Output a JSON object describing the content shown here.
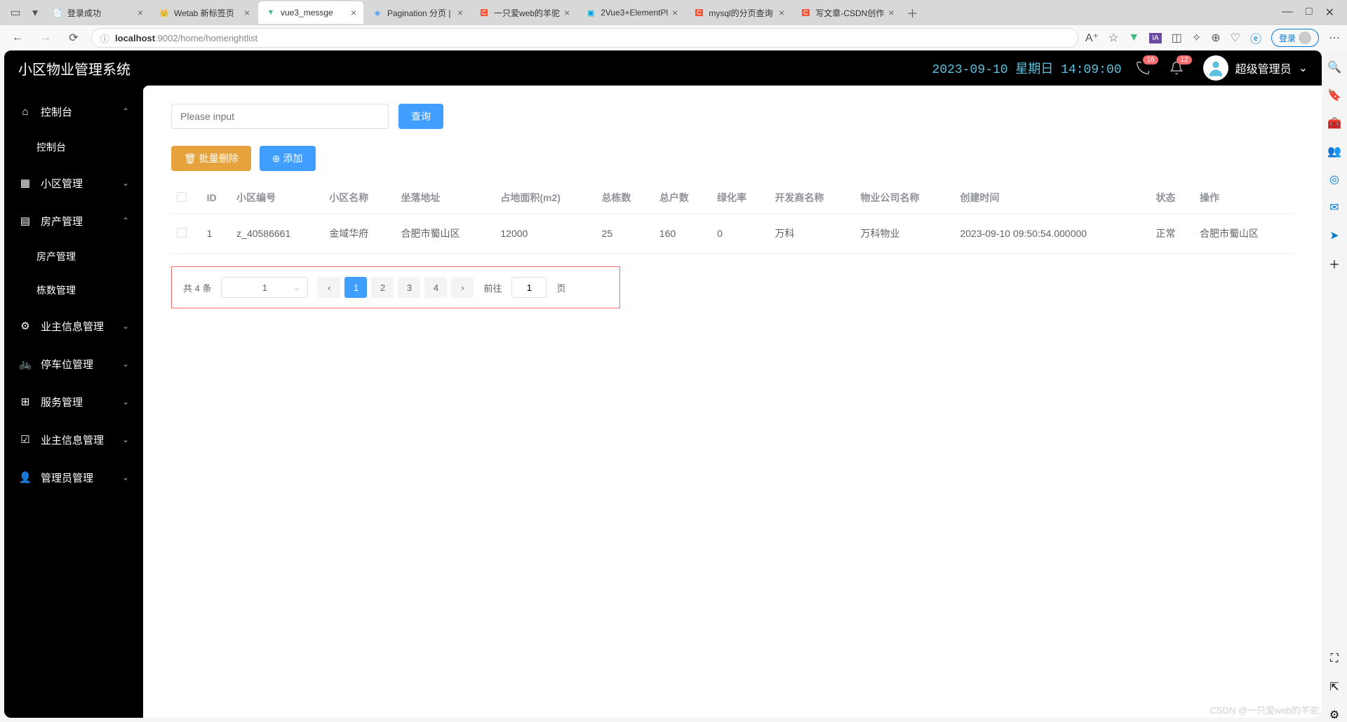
{
  "browser": {
    "tabs": [
      {
        "title": "登录成功",
        "active": false,
        "icon": "page"
      },
      {
        "title": "Wetab 新标签页",
        "active": false,
        "icon": "wetab"
      },
      {
        "title": "vue3_messge",
        "active": true,
        "icon": "vue"
      },
      {
        "title": "Pagination 分页 |",
        "active": false,
        "icon": "element"
      },
      {
        "title": "一只爱web的羊驼",
        "active": false,
        "icon": "csdn"
      },
      {
        "title": "2Vue3+ElementPl",
        "active": false,
        "icon": "bili"
      },
      {
        "title": "mysql的分页查询",
        "active": false,
        "icon": "csdn"
      },
      {
        "title": "写文章-CSDN创作",
        "active": false,
        "icon": "csdn"
      }
    ],
    "url_host": "localhost",
    "url_port": ":9002",
    "url_path": "/home/homerightlist",
    "login_label": "登录"
  },
  "header": {
    "app_title": "小区物业管理系统",
    "datetime": "2023-09-10 星期日 14:09:00",
    "badge1": "16",
    "badge2": "12",
    "user_role": "超级管理员"
  },
  "sidebar": {
    "items": [
      {
        "label": "控制台",
        "icon": "⌂",
        "expanded": true,
        "children": [
          {
            "label": "控制台"
          }
        ]
      },
      {
        "label": "小区管理",
        "icon": "▦",
        "expanded": false
      },
      {
        "label": "房产管理",
        "icon": "▤",
        "expanded": true,
        "children": [
          {
            "label": "房产管理"
          },
          {
            "label": "栋数管理"
          }
        ]
      },
      {
        "label": "业主信息管理",
        "icon": "⚙",
        "expanded": false
      },
      {
        "label": "停车位管理",
        "icon": "🚲",
        "expanded": false
      },
      {
        "label": "服务管理",
        "icon": "⊞",
        "expanded": false
      },
      {
        "label": "业主信息管理",
        "icon": "☑",
        "expanded": false
      },
      {
        "label": "管理员管理",
        "icon": "👤",
        "expanded": false
      }
    ]
  },
  "content": {
    "search_placeholder": "Please input",
    "query_btn": "查询",
    "batch_delete_btn": "批量删除",
    "add_btn": "添加",
    "columns": [
      "",
      "ID",
      "小区编号",
      "小区名称",
      "坐落地址",
      "占地面积(m2)",
      "总栋数",
      "总户数",
      "绿化率",
      "开发商名称",
      "物业公司名称",
      "创建时间",
      "状态",
      "操作"
    ],
    "rows": [
      {
        "id": "1",
        "code": "z_40586661",
        "name": "金域华府",
        "addr": "合肥市蜀山区",
        "area": "12000",
        "bldg": "25",
        "house": "160",
        "green": "0",
        "dev": "万科",
        "pm": "万科物业",
        "ctime": "2023-09-10 09:50:54.000000",
        "status": "正常",
        "op": "合肥市蜀山区"
      }
    ],
    "pagination": {
      "total_label": "共 4 条",
      "page_size": "1",
      "pages": [
        "1",
        "2",
        "3",
        "4"
      ],
      "active_page": "1",
      "goto_label": "前往",
      "goto_value": "1",
      "goto_suffix": "页"
    }
  },
  "watermark": "CSDN @一只爱web的羊驼"
}
